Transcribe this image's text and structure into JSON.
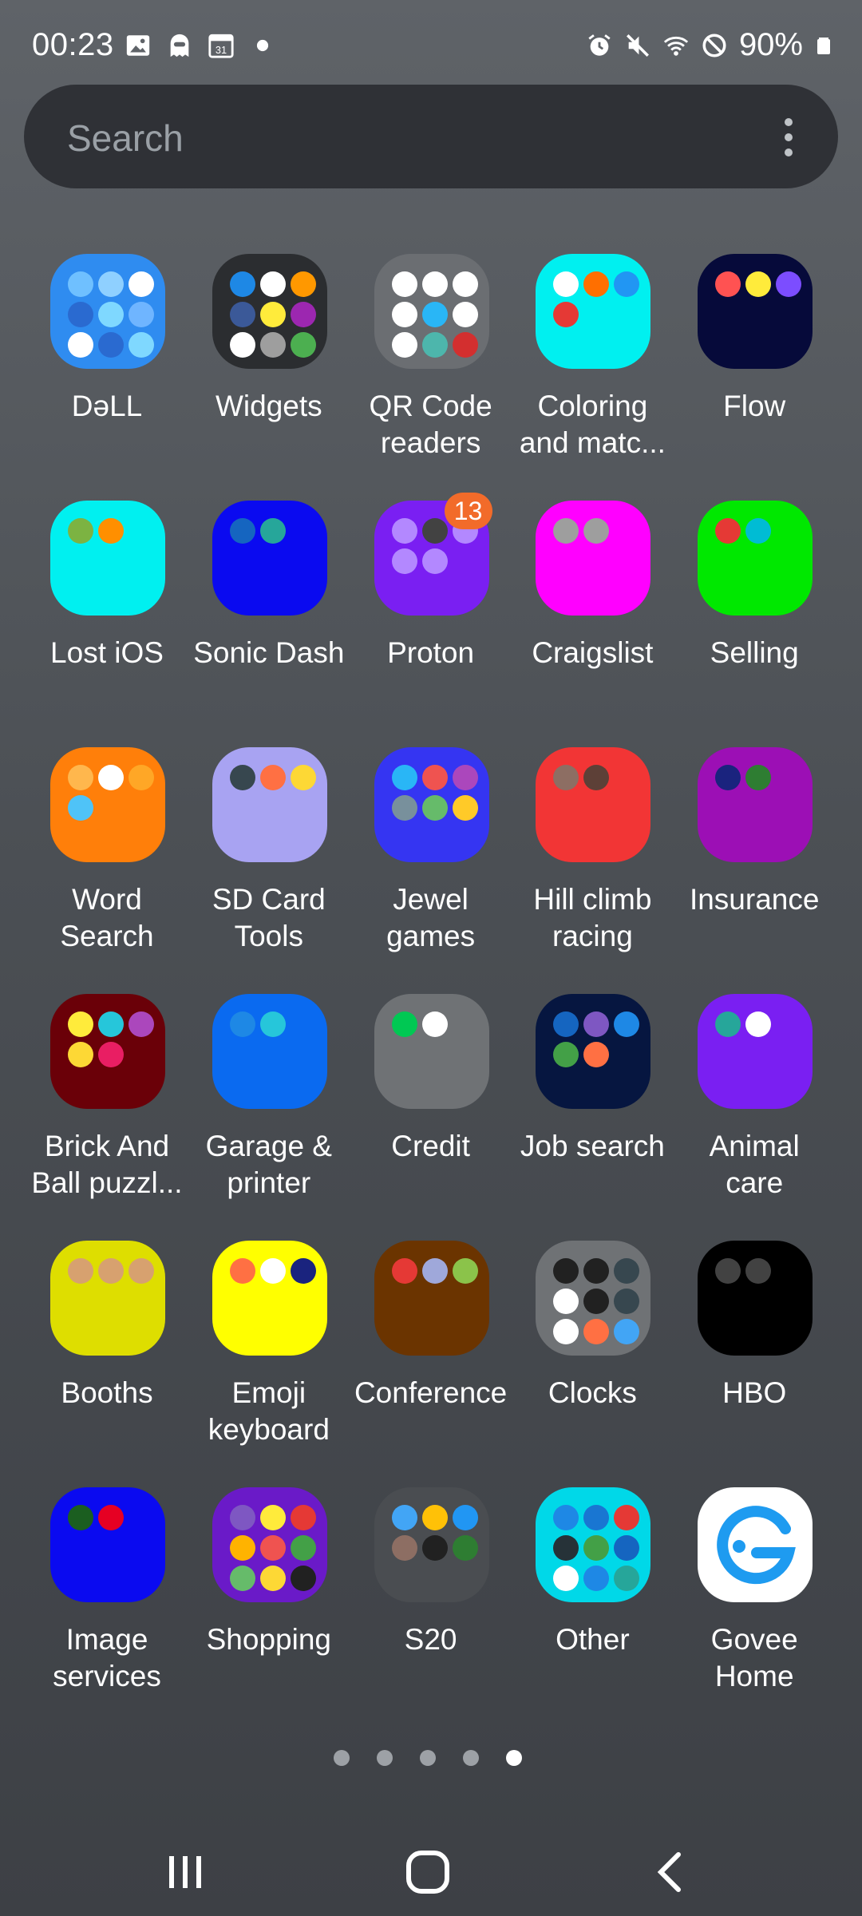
{
  "status_bar": {
    "time": "00:23",
    "battery": "90%",
    "left_icons": [
      "image-icon",
      "ghost-icon",
      "calendar-icon",
      "dot-icon"
    ],
    "right_icons": [
      "alarm-icon",
      "mute-icon",
      "wifi-icon",
      "do-not-disturb-icon",
      "battery-icon"
    ]
  },
  "search": {
    "placeholder": "Search"
  },
  "folders": [
    {
      "label": "DəLL",
      "bg": "#2f8cf0",
      "minis": [
        "#6fc0ff",
        "#8fd0ff",
        "#ffffff",
        "#2a6ad0",
        "#7fd8ff",
        "#6fb5ff",
        "#ffffff",
        "#2a6ad0",
        "#7fd8ff"
      ]
    },
    {
      "label": "Widgets",
      "bg": "#2b2d30",
      "minis": [
        "#1e88e5",
        "#ffffff",
        "#ff9800",
        "#3b5998",
        "#ffeb3b",
        "#9c27b0",
        "#ffffff",
        "#9e9e9e",
        "#4caf50"
      ]
    },
    {
      "label": "QR Code\nreaders",
      "bg": "#6b6e72",
      "minis": [
        "#ffffff",
        "#ffffff",
        "#ffffff",
        "#ffffff",
        "#29b6f6",
        "#ffffff",
        "#ffffff",
        "#4db6ac",
        "#d32f2f"
      ]
    },
    {
      "label": "Coloring\nand matc...",
      "bg": "#00f0f0",
      "minis": [
        "#ffffff",
        "#ff6f00",
        "#2196f3",
        "#e53935"
      ]
    },
    {
      "label": "Flow",
      "bg": "#060a3a",
      "minis": [
        "#ff5252",
        "#ffeb3b",
        "#7c4dff"
      ]
    },
    {
      "label": "Lost iOS",
      "bg": "#00f0f0",
      "minis": [
        "#7cb342",
        "#ff8f00"
      ]
    },
    {
      "label": "Sonic Dash",
      "bg": "#0a0af0",
      "minis": [
        "#1565c0",
        "#26a69a"
      ]
    },
    {
      "label": "Proton",
      "bg": "#7a1ff2",
      "minis": [
        "#b388ff",
        "#424242",
        "#b388ff",
        "#b388ff",
        "#b388ff"
      ],
      "badge": "13"
    },
    {
      "label": "Craigslist",
      "bg": "#ff00ff",
      "minis": [
        "#9e9e9e",
        "#9e9e9e"
      ]
    },
    {
      "label": "Selling",
      "bg": "#00e800",
      "minis": [
        "#e53935",
        "#00bcd4"
      ]
    },
    {
      "label": "Word\nSearch",
      "bg": "#ff7f0a",
      "minis": [
        "#ffb74d",
        "#ffffff",
        "#ffa726",
        "#4fc3f7"
      ]
    },
    {
      "label": "SD Card\nTools",
      "bg": "#a8a3f2",
      "minis": [
        "#37474f",
        "#ff7043",
        "#fdd835"
      ]
    },
    {
      "label": "Jewel\ngames",
      "bg": "#3535f2",
      "minis": [
        "#29b6f6",
        "#ef5350",
        "#ab47bc",
        "#78909c",
        "#66bb6a",
        "#ffca28"
      ]
    },
    {
      "label": "Hill climb\nracing",
      "bg": "#f23535",
      "minis": [
        "#8d6e63",
        "#5d4037"
      ]
    },
    {
      "label": "Insurance",
      "bg": "#9c0fb5",
      "minis": [
        "#1a237e",
        "#2e7d32"
      ]
    },
    {
      "label": "Brick And\nBall puzzl...",
      "bg": "#6a0008",
      "minis": [
        "#ffeb3b",
        "#26c6da",
        "#ab47bc",
        "#fdd835",
        "#e91e63"
      ]
    },
    {
      "label": "Garage &\nprinter",
      "bg": "#0a6af0",
      "minis": [
        "#1e88e5",
        "#26c6da"
      ]
    },
    {
      "label": "Credit",
      "bg": "#6f7275",
      "minis": [
        "#00c853",
        "#ffffff"
      ]
    },
    {
      "label": "Job search",
      "bg": "#061640",
      "minis": [
        "#1565c0",
        "#7e57c2",
        "#1e88e5",
        "#43a047",
        "#ff7043"
      ]
    },
    {
      "label": "Animal\ncare",
      "bg": "#7a1ff2",
      "minis": [
        "#26a69a",
        "#ffffff"
      ]
    },
    {
      "label": "Booths",
      "bg": "#dede00",
      "minis": [
        "#d7a16f",
        "#d7a16f",
        "#d7a16f"
      ]
    },
    {
      "label": "Emoji\nkeyboard",
      "bg": "#ffff00",
      "minis": [
        "#ff7043",
        "#ffffff",
        "#1a237e"
      ]
    },
    {
      "label": "Conference",
      "bg": "#6b3400",
      "minis": [
        "#e53935",
        "#9fa8da",
        "#8bc34a"
      ]
    },
    {
      "label": "Clocks",
      "bg": "#6f7275",
      "minis": [
        "#212121",
        "#212121",
        "#37474f",
        "#ffffff",
        "#212121",
        "#37474f",
        "#ffffff",
        "#ff7043",
        "#42a5f5"
      ]
    },
    {
      "label": "HBO",
      "bg": "#000000",
      "minis": [
        "#424242",
        "#424242"
      ]
    },
    {
      "label": "Image\nservices",
      "bg": "#0a0af0",
      "minis": [
        "#1b5e20",
        "#e60023"
      ]
    },
    {
      "label": "Shopping",
      "bg": "#6a1ac8",
      "minis": [
        "#7e57c2",
        "#ffeb3b",
        "#e53935",
        "#ffb300",
        "#ef5350",
        "#43a047",
        "#66bb6a",
        "#fdd835",
        "#212121"
      ]
    },
    {
      "label": "S20",
      "bg": "#4a4d51",
      "minis": [
        "#42a5f5",
        "#ffc107",
        "#2196f3",
        "#8d6e63",
        "#212121",
        "#2e7d32"
      ]
    },
    {
      "label": "Other",
      "bg": "#00d8e8",
      "minis": [
        "#1e88e5",
        "#1976d2",
        "#e53935",
        "#263238",
        "#43a047",
        "#1565c0",
        "#ffffff",
        "#1e88e5",
        "#26a69a"
      ]
    },
    {
      "label": "Govee\nHome",
      "bg": "#ffffff",
      "app": true,
      "icon": "govee-logo-icon",
      "accent": "#1e9bf0"
    }
  ],
  "page_indicator": {
    "count": 5,
    "active": 5
  },
  "nav_bar": {
    "buttons": [
      "recent-apps-icon",
      "home-icon",
      "back-icon"
    ]
  }
}
